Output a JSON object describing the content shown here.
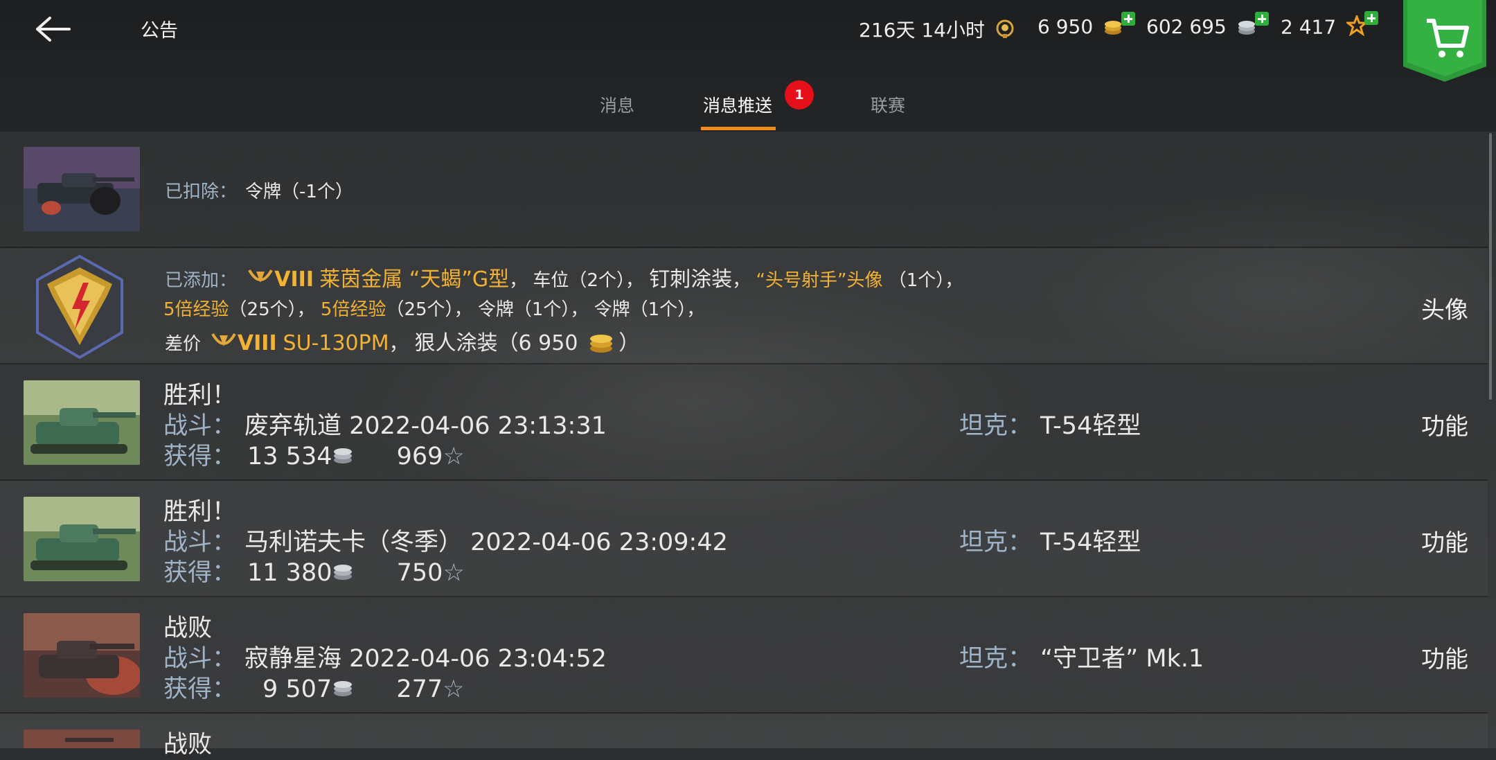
{
  "header": {
    "title": "公告",
    "premium_time": "216天 14小时",
    "gold": "6 950",
    "credits": "602 695",
    "free_xp": "2 417",
    "icons": {
      "back": "back-arrow-icon",
      "premium": "premium-laurel-icon",
      "gold": "gold-coins-icon",
      "credits": "silver-coins-icon",
      "free_xp": "star-icon",
      "shop": "shopping-cart-icon"
    }
  },
  "tabs": {
    "messages": "消息",
    "push": "消息推送",
    "push_badge": "1",
    "league": "联赛",
    "active": "消息推送"
  },
  "list": {
    "row1": {
      "label": "已扣除：",
      "value": "令牌（-1个）"
    },
    "row2": {
      "label": "已添加：",
      "tier1": "VIII",
      "tank1": "莱茵金属 “天蝎”G型",
      "sep1": "，",
      "item_a": "车位（2个）",
      "sep2": "，",
      "item_b": "钉刺涂装",
      "sep3": "，",
      "item_c": "“头号射手”头像",
      "item_c_count": "（1个）",
      "sep4": "，",
      "item_d": "5倍经验",
      "item_d_count": "（25个）",
      "sep5": "，",
      "item_e": "5倍经验",
      "item_e_count": "（25个）",
      "sep6": "，",
      "item_f": "令牌（1个）",
      "sep7": "，",
      "item_g": "令牌（1个）",
      "sep8": "，",
      "diff_label": "差价",
      "tier2": "VIII",
      "tank2": "SU-130PM",
      "sep9": "，",
      "item_h": "狠人涂装（6 950",
      "item_h_close": "）",
      "action": "头像"
    },
    "battles": [
      {
        "result": "胜利！",
        "battle_label": "战斗：",
        "battle": "废弃轨道 2022-04-06 23:13:31",
        "earn_label": "获得：",
        "credits": "13 534",
        "xp": "969",
        "tank_label": "坦克：",
        "tank": "T-54轻型",
        "action": "功能"
      },
      {
        "result": "胜利！",
        "battle_label": "战斗：",
        "battle": "马利诺夫卡（冬季） 2022-04-06 23:09:42",
        "earn_label": "获得：",
        "credits": "11 380",
        "xp": "750",
        "tank_label": "坦克：",
        "tank": "T-54轻型",
        "action": "功能"
      },
      {
        "result": "战败",
        "battle_label": "战斗：",
        "battle": "寂静星海 2022-04-06 23:04:52",
        "earn_label": "获得：",
        "credits": "9 507",
        "xp": "277",
        "tank_label": "坦克：",
        "tank": "“守卫者” Mk.1",
        "action": "功能"
      },
      {
        "result": "战败"
      }
    ],
    "xp_glyph": "☆"
  },
  "colors": {
    "accent_orange": "#f08a1c",
    "badge_red": "#e6101b",
    "label_blue": "#9fb4c8",
    "gold_text": "#f2b233",
    "shop_green": "#2fae3c"
  }
}
